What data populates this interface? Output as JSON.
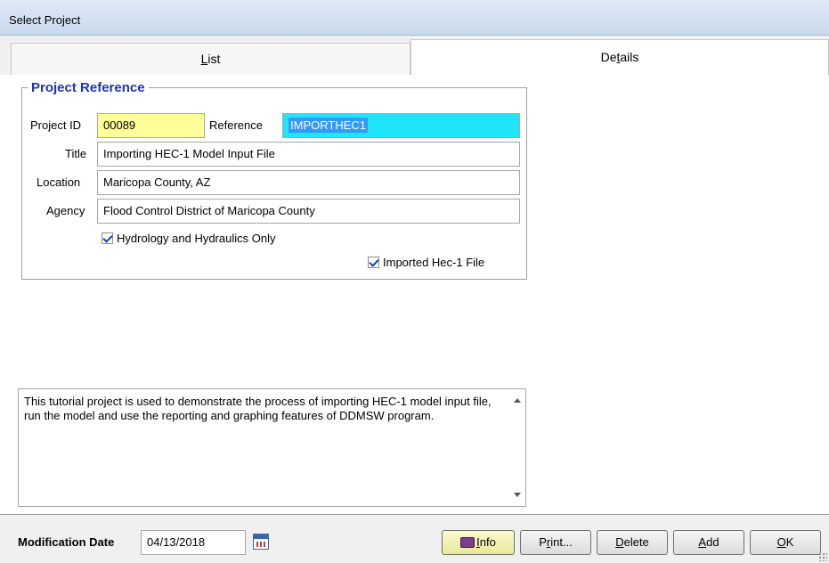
{
  "window": {
    "title": "Select Project"
  },
  "tabs": [
    {
      "label_pre": "",
      "label_key": "L",
      "label_post": "ist"
    },
    {
      "label_pre": "De",
      "label_key": "t",
      "label_post": "ails"
    }
  ],
  "project_reference": {
    "legend": "Project Reference",
    "project_id_label": "Project ID",
    "project_id": "00089",
    "reference_label": "Reference",
    "reference": "IMPORTHEC1",
    "title_label": "Title",
    "title": "Importing HEC-1 Model Input File",
    "location_label": "Location",
    "location": "Maricopa County, AZ",
    "agency_label": "Agency",
    "agency": "Flood Control District of Maricopa County",
    "hydrology_only_label": "Hydrology and Hydraulics Only",
    "imported_hec1_label": "Imported Hec-1 File"
  },
  "description": "This tutorial project is used to demonstrate the process of importing HEC-1 model input file, run the model and use the reporting and graphing features of DDMSW program.",
  "footer": {
    "mod_date_label": "Modification Date",
    "mod_date": "04/13/2018",
    "buttons": {
      "info": {
        "key": "I",
        "rest": "nfo"
      },
      "print": {
        "pre": "P",
        "key": "r",
        "rest": "int..."
      },
      "delete": {
        "key": "D",
        "rest": "elete"
      },
      "add": {
        "key": "A",
        "rest": "dd"
      },
      "ok": {
        "key": "O",
        "rest": "K"
      }
    }
  },
  "colors": {
    "project_id_bg": "#ffff99",
    "reference_bg": "#1ee6f7",
    "legend": "#1d34b4"
  }
}
